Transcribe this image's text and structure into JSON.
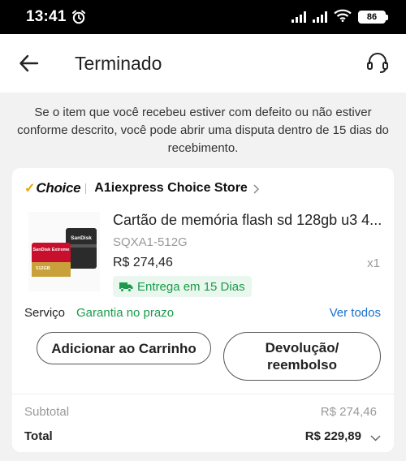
{
  "status_bar": {
    "time": "13:41",
    "battery": "86",
    "icons": [
      "alarm-icon",
      "signal-icon",
      "signal-icon",
      "wifi-icon",
      "battery-icon"
    ]
  },
  "header": {
    "title": "Terminado",
    "back_icon": "arrow-left-icon",
    "support_icon": "headset-icon"
  },
  "notice": "Se o item que você recebeu estiver com defeito ou não estiver conforme descrito, você pode abrir uma disputa dentro de 15 dias do recebimento.",
  "store": {
    "choice_check": "✓",
    "choice_label": "Choice",
    "name": "A1iexpress Choice Store"
  },
  "product": {
    "title": "Cartão de memória flash sd 128gb u3 4...",
    "sku": "SQXA1-512G",
    "price": "R$ 274,46",
    "quantity": "x1",
    "delivery": "Entrega em 15 Dias",
    "thumb_brand_red": "SanDisk Extreme",
    "thumb_brand_black": "SanDisk",
    "thumb_capacity": "512GB"
  },
  "service": {
    "label": "Serviço",
    "value": "Garantia no prazo",
    "view_all": "Ver todos"
  },
  "actions": {
    "add_to_cart": "Adicionar ao Carrinho",
    "return_refund": "Devolução/ reembolso"
  },
  "summary": {
    "subtotal_label": "Subtotal",
    "subtotal_value": "R$ 274,46",
    "total_label": "Total",
    "total_value": "R$ 229,89"
  },
  "colors": {
    "accent_green": "#1a9a4a",
    "link_blue": "#1a6fce",
    "choice_gold": "#f5a000",
    "delivery_bg": "#eaf7ee"
  }
}
